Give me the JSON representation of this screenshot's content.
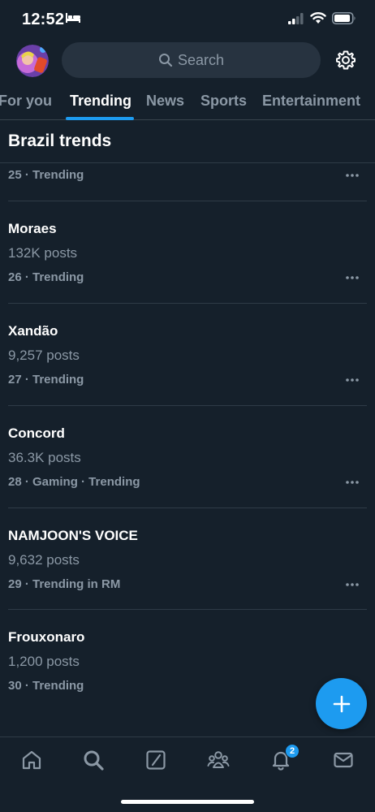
{
  "status_bar": {
    "time": "12:52"
  },
  "header": {
    "search_placeholder": "Search"
  },
  "tabs": [
    {
      "label": "For you",
      "active": false
    },
    {
      "label": "Trending",
      "active": true
    },
    {
      "label": "News",
      "active": false
    },
    {
      "label": "Sports",
      "active": false
    },
    {
      "label": "Entertainment",
      "active": false
    }
  ],
  "section_title": "Brazil trends",
  "trends": [
    {
      "meta": "25 · Trending"
    },
    {
      "title": "Moraes",
      "count": "132K posts",
      "meta": "26 · Trending"
    },
    {
      "title": "Xandão",
      "count": "9,257 posts",
      "meta": "27 · Trending"
    },
    {
      "title": "Concord",
      "count": "36.3K posts",
      "meta": "28 · Gaming · Trending"
    },
    {
      "title": "NAMJOON'S VOICE",
      "count": "9,632 posts",
      "meta": "29 · Trending in RM"
    },
    {
      "title": "Frouxonaro",
      "count": "1,200 posts",
      "meta": "30 · Trending"
    }
  ],
  "bottom_nav": {
    "items": [
      "home-icon",
      "search-icon",
      "grok-icon",
      "communities-icon",
      "notifications-icon",
      "messages-icon"
    ],
    "notifications_badge": "2"
  },
  "colors": {
    "background": "#15202b",
    "accent": "#1d9bf0",
    "muted_text": "#8b98a5"
  }
}
